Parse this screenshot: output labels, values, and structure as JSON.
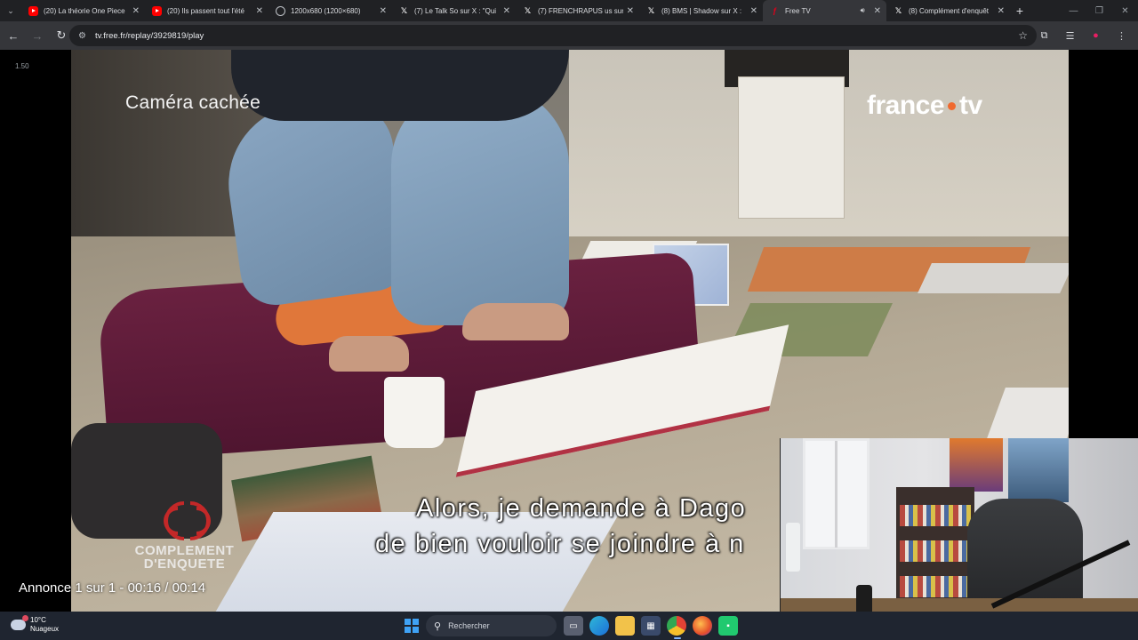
{
  "browser": {
    "tabs": [
      {
        "title": "(20) La théorie One Piece",
        "favicon": "youtube-icon",
        "active": false
      },
      {
        "title": "(20) Ils passent tout l'été",
        "favicon": "youtube-icon",
        "active": false
      },
      {
        "title": "1200x680 (1200×680)",
        "favicon": "globe-icon",
        "active": false
      },
      {
        "title": "(7) Le Talk So sur X : \"Qui",
        "favicon": "x-icon",
        "active": false
      },
      {
        "title": "(7) FRENCHRAPUS us sur",
        "favicon": "x-icon",
        "active": false
      },
      {
        "title": "(8) BMS | Shadow sur X :",
        "favicon": "x-icon",
        "active": false
      },
      {
        "title": "Free TV",
        "favicon": "free-icon",
        "active": true,
        "audio": true
      },
      {
        "title": "(8) Complément d'enquêt",
        "favicon": "x-icon",
        "active": false
      }
    ],
    "address": {
      "url": "tv.free.fr/replay/3929819/play"
    }
  },
  "video": {
    "speed_label": "1.50",
    "camera_label": "Caméra cachée",
    "channel_logo": {
      "part1": "france",
      "part2": "tv"
    },
    "show_logo": {
      "line1": "COMPLEMENT",
      "line2": "D'ENQUETE"
    },
    "subtitle": {
      "line1": "Alors, je demande à Dago",
      "line2": "de bien vouloir se joindre à n"
    },
    "ad_status": "Annonce 1 sur 1 - 00:16 / 00:14"
  },
  "taskbar": {
    "weather": {
      "temp": "10°C",
      "condition": "Nuageux"
    },
    "search_placeholder": "Rechercher",
    "apps": [
      "task-view-icon",
      "edge-icon",
      "file-explorer-icon",
      "store-icon",
      "chrome-icon",
      "firefox-icon",
      "green-app-icon"
    ]
  },
  "colors": {
    "tab_bar": "#202124",
    "toolbar": "#35363a",
    "taskbar": "#1f2530",
    "france_tv_dot": "#f06a2f"
  }
}
